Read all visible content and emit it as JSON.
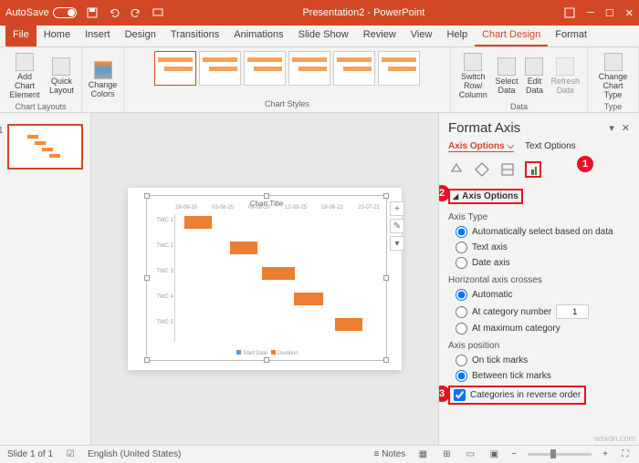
{
  "titlebar": {
    "autosave_label": "AutoSave",
    "autosave_state": "Off",
    "doc_title": "Presentation2 - PowerPoint"
  },
  "tabs": {
    "file": "File",
    "home": "Home",
    "insert": "Insert",
    "design": "Design",
    "transitions": "Transitions",
    "animations": "Animations",
    "slideshow": "Slide Show",
    "review": "Review",
    "view": "View",
    "help": "Help",
    "chart_design": "Chart Design",
    "format": "Format"
  },
  "ribbon": {
    "add_chart_element": "Add Chart\nElement",
    "quick_layout": "Quick\nLayout",
    "change_colors": "Change\nColors",
    "switch_row_col": "Switch Row/\nColumn",
    "select_data": "Select\nData",
    "edit_data": "Edit\nData",
    "refresh_data": "Refresh\nData",
    "change_chart_type": "Change\nChart Type",
    "g_layouts": "Chart Layouts",
    "g_styles": "Chart Styles",
    "g_data": "Data",
    "g_type": "Type"
  },
  "format_pane": {
    "title": "Format Axis",
    "tab_axis": "Axis Options",
    "tab_text": "Text Options",
    "section_axis_options": "Axis Options",
    "axis_type": "Axis Type",
    "opt_auto_data": "Automatically select based on data",
    "opt_text_axis": "Text axis",
    "opt_date_axis": "Date axis",
    "horiz_crosses": "Horizontal axis crosses",
    "opt_automatic": "Automatic",
    "opt_at_category": "At category number",
    "at_category_val": "1",
    "opt_at_max": "At maximum category",
    "axis_position": "Axis position",
    "opt_on_tick": "On tick marks",
    "opt_between_tick": "Between tick marks",
    "opt_reverse": "Categories in reverse order"
  },
  "callouts": {
    "c1": "1",
    "c2": "2",
    "c3": "3"
  },
  "chart": {
    "title": "Chart Title",
    "legend_start": "Start Date",
    "legend_dur": "Duration",
    "y": [
      "TWC 1",
      "TWC 2",
      "TWC 3",
      "TWC 4",
      "TWC 5"
    ],
    "x": [
      "28-09-20",
      "02-08-25",
      "08-08-20",
      "12-08-25",
      "18-06-22",
      "23-07-21"
    ]
  },
  "slide_num": "1",
  "status": {
    "slide": "Slide 1 of 1",
    "lang": "English (United States)",
    "notes": "Notes"
  },
  "watermark": "wsxdn.com"
}
